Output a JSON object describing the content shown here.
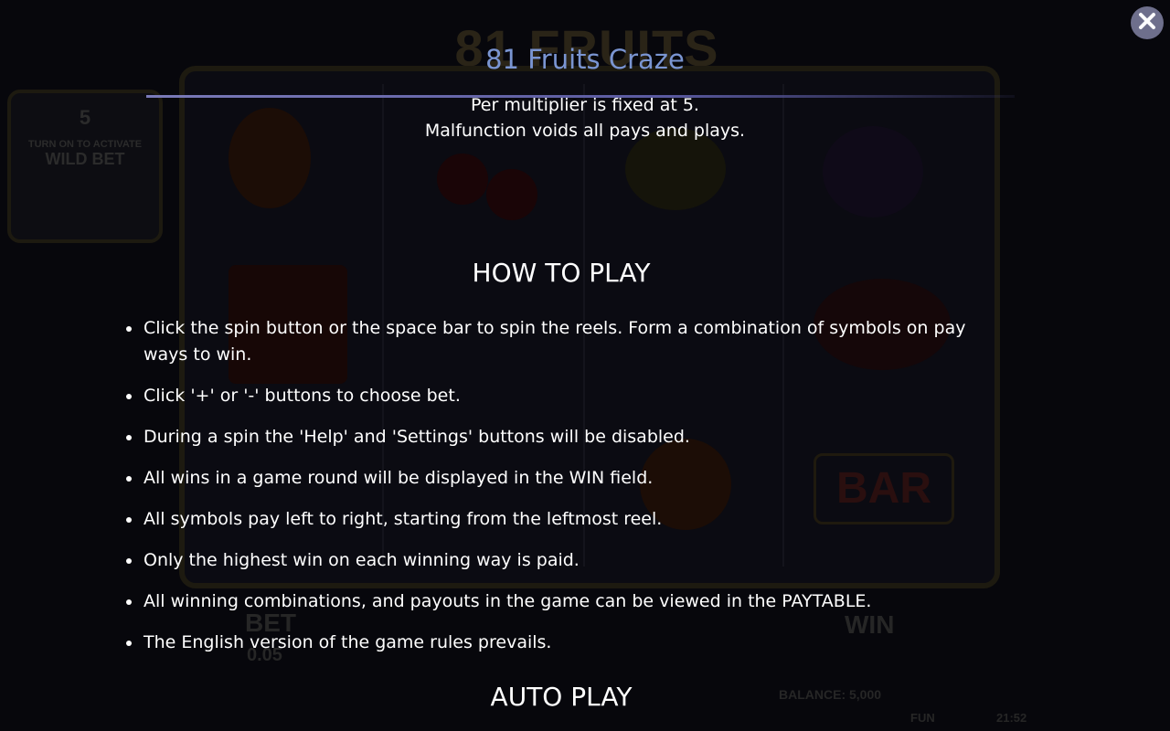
{
  "background": {
    "game_title": "81 FRUITS CRAZE",
    "wild_bet_value": "5",
    "wild_bet_hint": "TURN ON TO ACTIVATE",
    "wild_bet_label": "WILD BET",
    "bar_symbol": "BAR",
    "bet_label": "BET",
    "bet_value": "0.05",
    "win_label": "WIN",
    "balance_text": "BALANCE: 5,000",
    "mode_text": "FUN",
    "clock_text": "21:52"
  },
  "overlay": {
    "title": "81 Fruits Craze",
    "top_lines": [
      "Per multiplier is fixed at 5.",
      "Malfunction voids all pays and plays."
    ],
    "how_to_play": {
      "heading": "HOW TO PLAY",
      "items": [
        "Click the spin button or the space bar to spin the reels. Form a combination of symbols on pay ways to win.",
        "Click '+' or '-' buttons to choose bet.",
        "During a spin the 'Help' and 'Settings' buttons will be disabled.",
        "All wins in a game round will be displayed in the WIN field.",
        "All symbols pay left to right, starting from the leftmost reel.",
        "Only the highest win on each winning way is paid.",
        "All winning combinations, and payouts in the game can be viewed in the PAYTABLE.",
        "The English version of the game rules prevails."
      ]
    },
    "auto_play": {
      "heading": "AUTO PLAY"
    },
    "close_icon": "close-icon"
  },
  "colors": {
    "title": "#7a95d2",
    "text": "#ffffff",
    "close_button": "#6e6f8c",
    "backdrop": "#07070c"
  }
}
